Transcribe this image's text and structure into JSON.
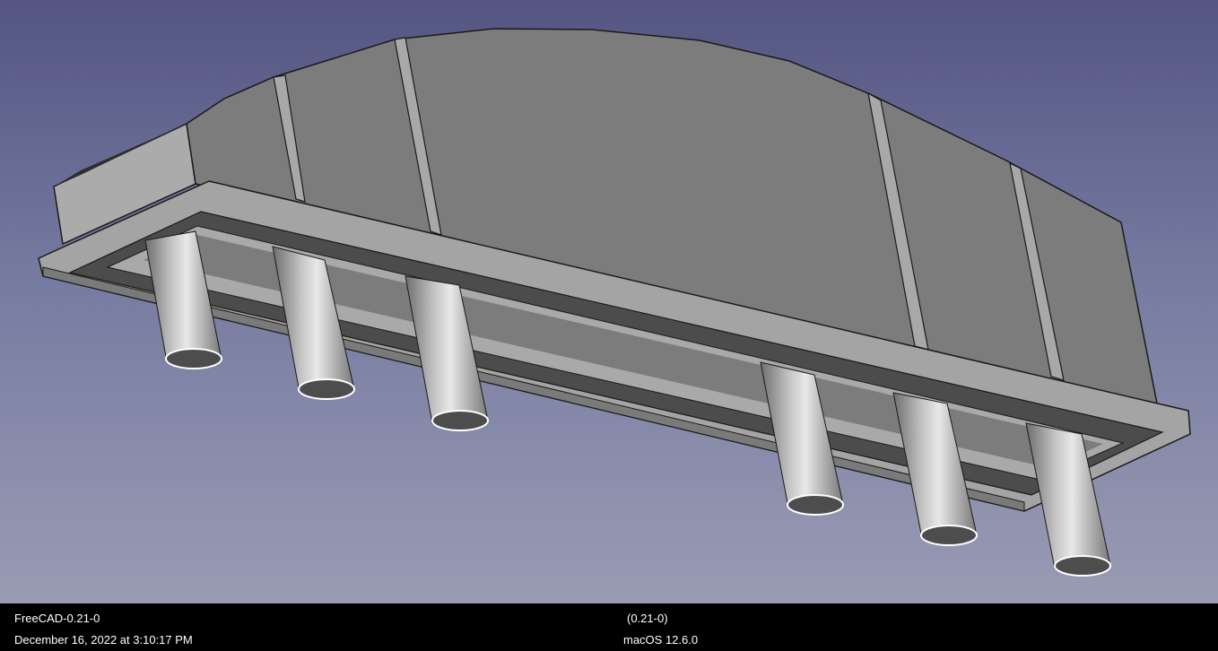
{
  "status_bar": {
    "app_version": "FreeCAD-0.21-0",
    "date": "December 16, 2022 at 3:10:17 PM",
    "version_short": "(0.21-0)",
    "os": "macOS 12.6.0"
  },
  "colors": {
    "viewport_top": "#545582",
    "viewport_bottom": "#9a9bb4",
    "body_face": "#7c7c7c",
    "rib_face": "#a8a8a8",
    "flange_face": "#a4a4a4",
    "flange_groove": "#4c4c4c",
    "status_bar_bg": "#000000",
    "status_bar_text": "#ffffff"
  }
}
